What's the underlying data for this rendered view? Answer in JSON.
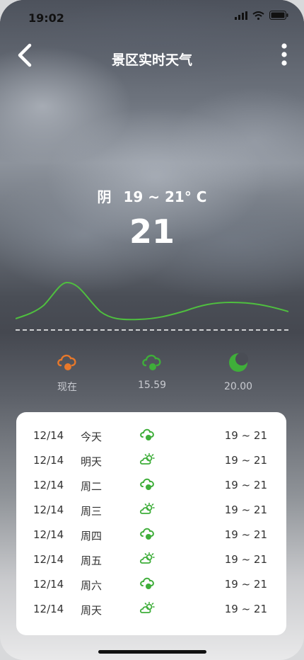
{
  "status": {
    "time": "19:02"
  },
  "nav": {
    "title": "景区实时天气"
  },
  "current": {
    "condition": "阴",
    "range": "19 ~ 21° C",
    "temperature": "21"
  },
  "hourly": [
    {
      "label": "现在",
      "icon": "cloud-sun-orange-icon",
      "color": "#e8782a"
    },
    {
      "label": "15.59",
      "icon": "cloud-sun-green-icon",
      "color": "#3fae3a"
    },
    {
      "label": "20.00",
      "icon": "moon-green-icon",
      "color": "#3fae3a"
    }
  ],
  "forecast": [
    {
      "date": "12/14",
      "day": "今天",
      "icon": "cloud-sun-icon",
      "range": "19 ~ 21"
    },
    {
      "date": "12/14",
      "day": "明天",
      "icon": "partly-sunny-icon",
      "range": "19 ~ 21"
    },
    {
      "date": "12/14",
      "day": "周二",
      "icon": "cloud-sun-icon",
      "range": "19 ~ 21"
    },
    {
      "date": "12/14",
      "day": "周三",
      "icon": "partly-sunny-icon",
      "range": "19 ~ 21"
    },
    {
      "date": "12/14",
      "day": "周四",
      "icon": "cloud-sun-icon",
      "range": "19 ~ 21"
    },
    {
      "date": "12/14",
      "day": "周五",
      "icon": "partly-sunny-icon",
      "range": "19 ~ 21"
    },
    {
      "date": "12/14",
      "day": "周六",
      "icon": "cloud-sun-icon",
      "range": "19 ~ 21"
    },
    {
      "date": "12/14",
      "day": "周天",
      "icon": "partly-sunny-icon",
      "range": "19 ~ 21"
    }
  ],
  "colors": {
    "accent_green": "#3fae3a",
    "accent_orange": "#e8782a",
    "curve": "#4fbf3f"
  }
}
